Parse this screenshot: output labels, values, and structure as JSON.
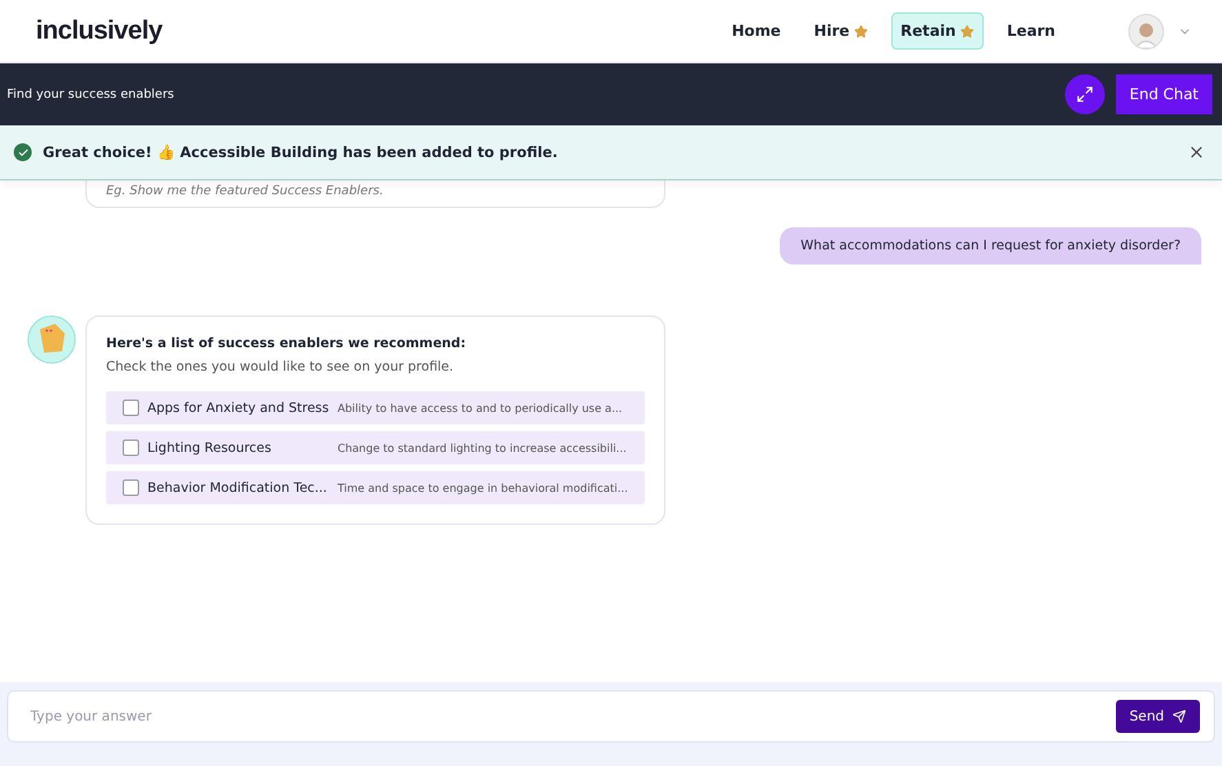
{
  "header": {
    "logo": "inclusively",
    "nav": [
      {
        "label": "Home",
        "starred": false,
        "selected": false
      },
      {
        "label": "Hire",
        "starred": true,
        "selected": false
      },
      {
        "label": "Retain",
        "starred": true,
        "selected": true
      },
      {
        "label": "Learn",
        "starred": false,
        "selected": false
      }
    ]
  },
  "chat_bar": {
    "title": "Find your success enablers",
    "end_button": "End Chat"
  },
  "toast": {
    "message": "Great choice! 👍 Accessible Building has been added to profile."
  },
  "messages": [
    {
      "kind": "hint",
      "text": "Eg. Show me the featured Success Enablers."
    },
    {
      "kind": "user",
      "text": "What accommodations can I request for anxiety disorder?"
    },
    {
      "kind": "enablers",
      "title": "Here's a list of success enablers we recommend:",
      "subtitle": "Check the ones you would like to see on your profile.",
      "items": [
        {
          "name": "Apps for Anxiety and Stress",
          "description": "Ability to have access to and to periodically use a...",
          "checked": false
        },
        {
          "name": "Lighting Resources",
          "description": "Change to standard lighting to increase accessibili...",
          "checked": false
        },
        {
          "name": "Behavior Modification Tec...",
          "description": "Time and space to engage in behavioral modificati...",
          "checked": false
        }
      ]
    }
  ],
  "composer": {
    "placeholder": "Type your answer",
    "send_button": "Send"
  }
}
